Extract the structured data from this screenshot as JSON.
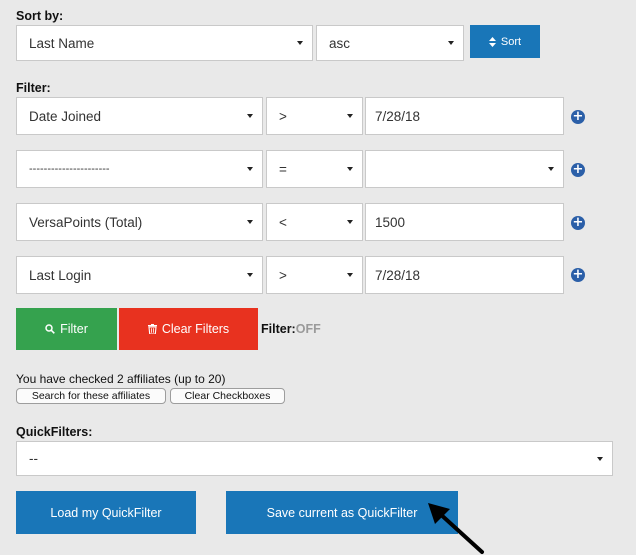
{
  "sort": {
    "label": "Sort by:",
    "field": "Last Name",
    "order": "asc",
    "button_label": "Sort",
    "button_icon": "sort-icon"
  },
  "filter": {
    "label": "Filter:",
    "rows": [
      {
        "field": "Date Joined",
        "operator": ">",
        "value": "7/28/18"
      },
      {
        "field": "----------------------",
        "operator": "=",
        "value": ""
      },
      {
        "field": "VersaPoints (Total)",
        "operator": "<",
        "value": "1500"
      },
      {
        "field": "Last Login",
        "operator": ">",
        "value": "7/28/18"
      }
    ],
    "add_icon": "plus-circle-icon",
    "filter_button": "Filter",
    "clear_button": "Clear Filters",
    "status_label": "Filter:",
    "status_value": "OFF"
  },
  "affiliates": {
    "checked_text": "You have checked 2 affiliates (up to 20)",
    "search_button": "Search for these affiliates",
    "clear_button": "Clear Checkboxes"
  },
  "quickfilters": {
    "label": "QuickFilters:",
    "selected": "--",
    "load_button": "Load my QuickFilter",
    "save_button": "Save current as QuickFilter"
  },
  "colors": {
    "primary_blue": "#1976b8",
    "filter_green": "#35a24e",
    "clear_red": "#e8321f",
    "off_gray": "#9a9a9a"
  }
}
